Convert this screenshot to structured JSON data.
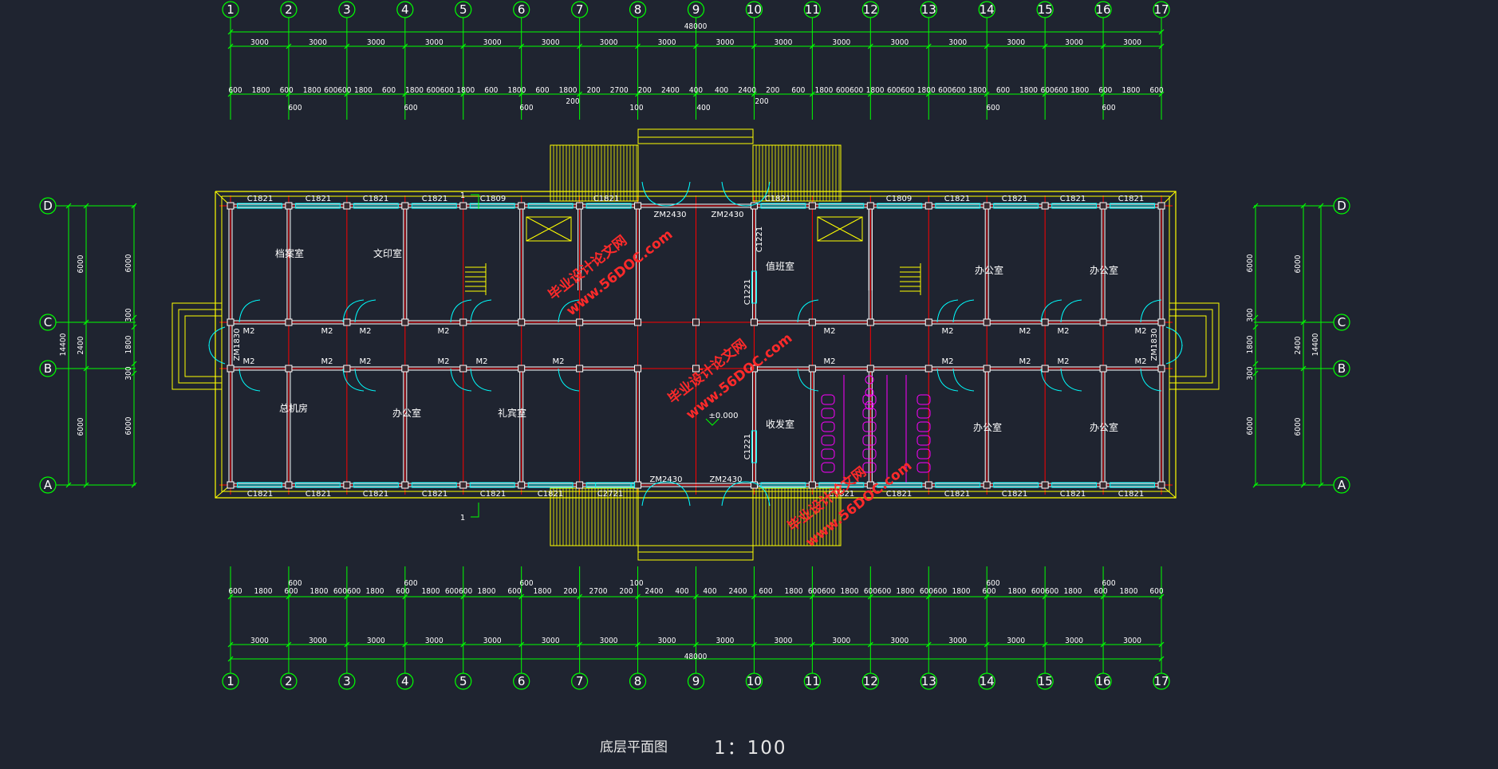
{
  "drawing": {
    "title": "底层平面图",
    "scale": "1：100",
    "elevation": "±0.000",
    "section_mark": "1"
  },
  "axes": {
    "columns": [
      "1",
      "2",
      "3",
      "4",
      "5",
      "6",
      "7",
      "8",
      "9",
      "10",
      "11",
      "12",
      "13",
      "14",
      "15",
      "16",
      "17"
    ],
    "rows": [
      "D",
      "C",
      "B",
      "A"
    ]
  },
  "dimensions": {
    "overall_length": "48000",
    "bay_widths": [
      "3000",
      "3000",
      "3000",
      "3000",
      "3000",
      "3000",
      "3000",
      "3000",
      "3000",
      "3000",
      "3000",
      "3000",
      "3000",
      "3000",
      "3000",
      "3000"
    ],
    "top_detail": [
      "600",
      "1800",
      "600",
      "1800",
      "600600",
      "1800",
      "600",
      "1800",
      "600600",
      "1800",
      "600",
      "1800",
      "600",
      "1800",
      "200",
      "2700",
      "200",
      "2400",
      "400",
      "400",
      "2400",
      "200",
      "600",
      "1800",
      "600600",
      "1800",
      "600600",
      "1800",
      "600600",
      "1800",
      "600",
      "1800",
      "600600",
      "1800",
      "600",
      "1800",
      "600"
    ],
    "top_sub": [
      "600",
      "600",
      "600",
      "200",
      "100",
      "400",
      "200",
      "600",
      "600"
    ],
    "bottom_detail": [
      "600",
      "1800",
      "600",
      "1800",
      "600600",
      "1800",
      "600",
      "1800",
      "600600",
      "1800",
      "600",
      "1800",
      "200",
      "2700",
      "200",
      "2400",
      "400",
      "400",
      "2400",
      "600",
      "1800",
      "600600",
      "1800",
      "600600",
      "1800",
      "600600",
      "1800",
      "600",
      "1800",
      "600600",
      "1800",
      "600",
      "1800",
      "600"
    ],
    "bottom_sub": [
      "600",
      "600",
      "600",
      "100",
      "600",
      "600"
    ],
    "vertical_overall": "14400",
    "vertical_bays": [
      "6000",
      "2400",
      "6000"
    ],
    "vertical_inner": [
      "6000",
      "300",
      "1800",
      "300",
      "6000"
    ]
  },
  "windows": {
    "top": [
      "C1821",
      "C1821",
      "C1821",
      "C1821",
      "C1809",
      "C1821",
      "C1821",
      "C1809",
      "C1821",
      "C1821",
      "C1821",
      "C1821"
    ],
    "bottom": [
      "C1821",
      "C1821",
      "C1821",
      "C1821",
      "C1821",
      "C1821",
      "C2721",
      "C1821",
      "C1821",
      "C1821",
      "C1821",
      "C1821",
      "C1821",
      "C1821"
    ],
    "side": [
      "C1221",
      "C1221",
      "C1221"
    ]
  },
  "doors": {
    "entrance": "ZM2430",
    "side_entrance": "ZM1830",
    "interior": "M2"
  },
  "rooms": {
    "north": [
      "档案室",
      "文印室",
      "值班室",
      "办公室",
      "办公室"
    ],
    "south": [
      "总机房",
      "办公室",
      "礼宾室",
      "收发室",
      "办公室",
      "办公室"
    ]
  },
  "watermark": {
    "line1": "毕业设计论文网",
    "line2": "www.56DOC.com"
  },
  "colors": {
    "background": "#1f2430",
    "dimension": "#00ff00",
    "wall": "#ffffff",
    "grid": "#ff0000",
    "outline": "#ffff00",
    "window": "#00ffff",
    "fixture": "#ff00ff",
    "watermark": "#ff2a2a"
  }
}
